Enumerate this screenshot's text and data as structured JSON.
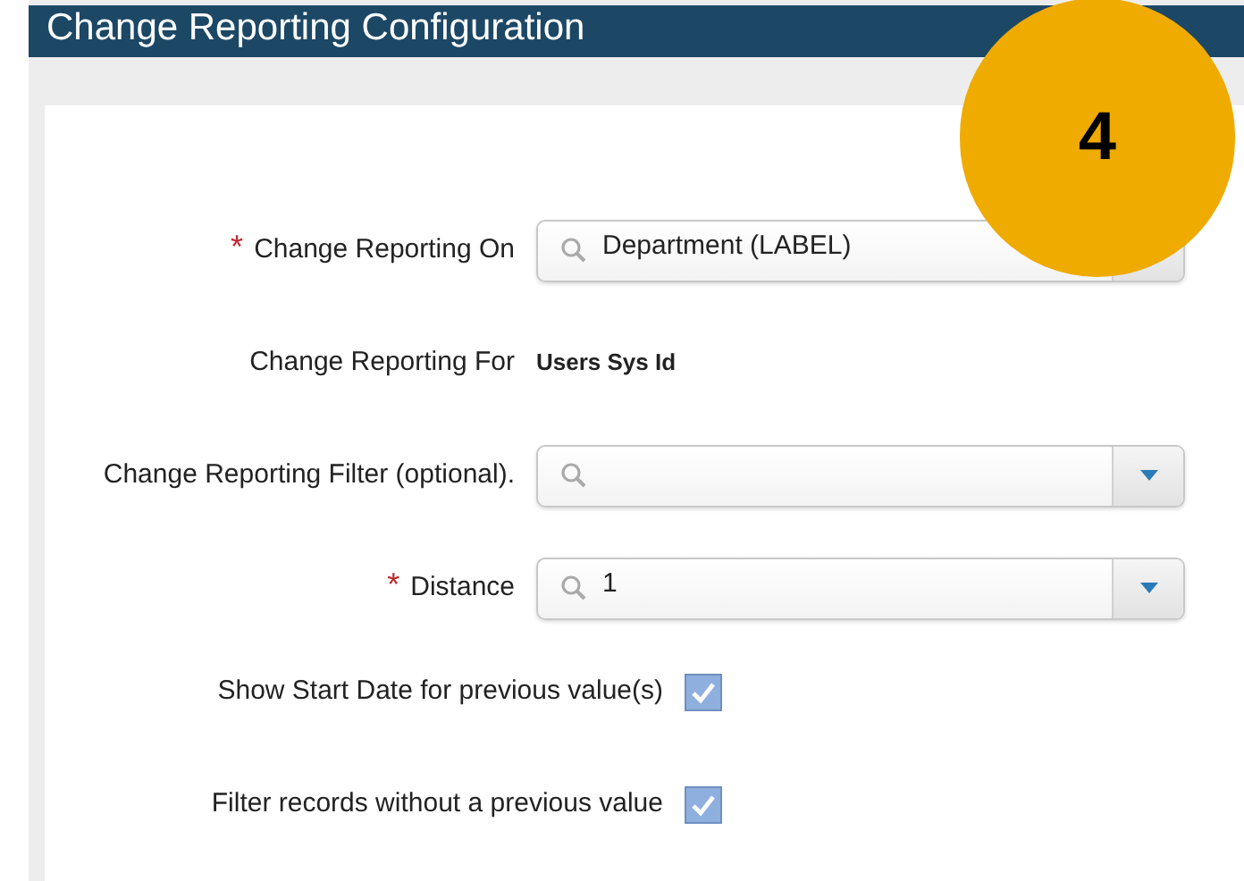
{
  "window": {
    "title": "Change Reporting Configuration"
  },
  "badge": {
    "text": "4"
  },
  "fields": [
    {
      "kind": "lookup",
      "label": "Change Reporting On",
      "required_mark": "*",
      "value": "Department (LABEL)"
    },
    {
      "kind": "readonly",
      "label": "Change Reporting For",
      "value": "Users Sys Id"
    },
    {
      "kind": "lookup",
      "label": "Change Reporting Filter (optional).",
      "caret_shown": true
    },
    {
      "kind": "lookup",
      "label": "Distance",
      "required_mark": "*",
      "value": "1",
      "caret_shown": true
    },
    {
      "kind": "checkbox",
      "label": "Show Start Date for previous value(s)",
      "checked": true
    },
    {
      "kind": "checkbox",
      "label": "Filter records without a previous value",
      "checked": true
    }
  ]
}
